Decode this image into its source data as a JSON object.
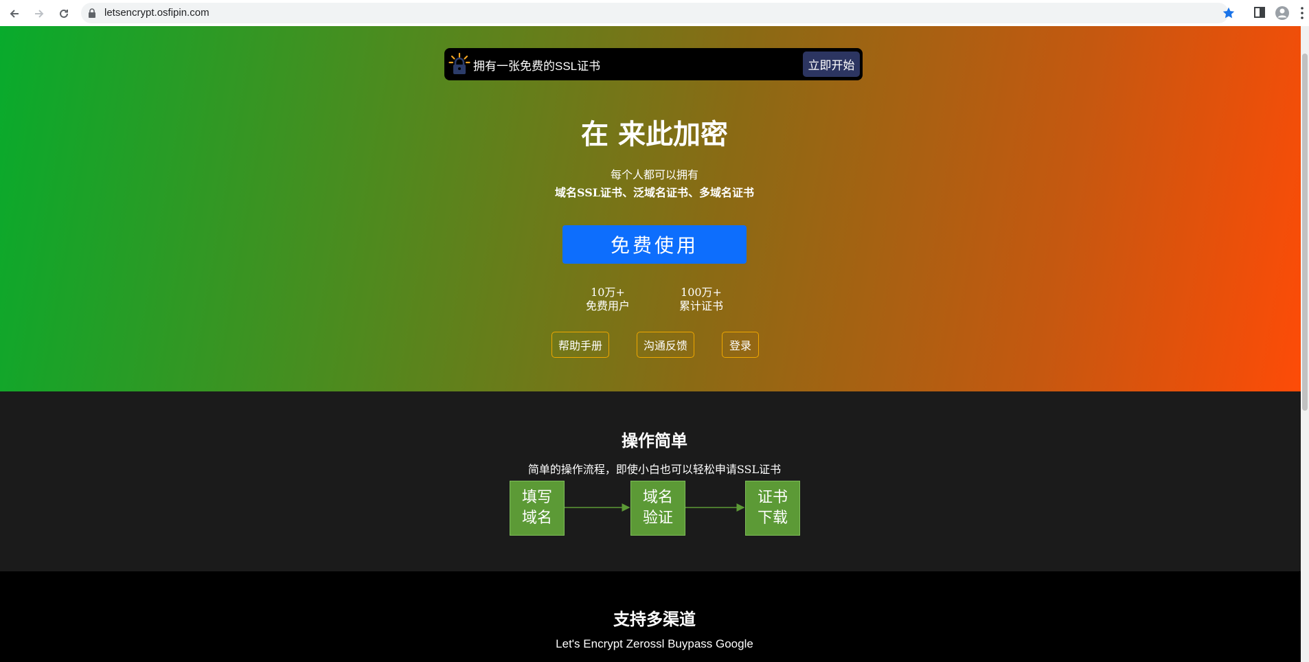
{
  "browser": {
    "url": "letsencrypt.osfipin.com"
  },
  "banner": {
    "text": "拥有一张免费的SSL证书",
    "button": "立即开始"
  },
  "hero": {
    "title": "在 来此加密",
    "subtitle_line1": "每个人都可以拥有",
    "subtitle_line2": "域名SSL证书、泛域名证书、多域名证书",
    "cta": "免费使用",
    "stats": [
      {
        "value": "10万+",
        "label": "免费用户"
      },
      {
        "value": "100万+",
        "label": "累计证书"
      }
    ],
    "links": [
      "帮助手册",
      "沟通反馈",
      "登录"
    ]
  },
  "process": {
    "title": "操作简单",
    "description": "简单的操作流程，即使小白也可以轻松申请SSL证书",
    "steps": [
      {
        "line1": "填写",
        "line2": "域名"
      },
      {
        "line1": "域名",
        "line2": "验证"
      },
      {
        "line1": "证书",
        "line2": "下载"
      }
    ],
    "step_color": "#5c9a36"
  },
  "channels": {
    "title": "支持多渠道",
    "description": "Let's Encrypt Zerossl Buypass Google"
  },
  "colors": {
    "gradient_start": "#08ab2c",
    "gradient_end": "#ff4b07",
    "cta": "#0d6efd",
    "link_border": "#f0a800"
  }
}
